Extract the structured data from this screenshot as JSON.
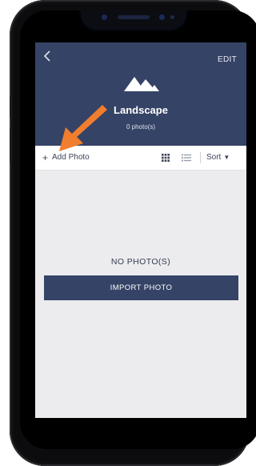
{
  "header": {
    "back_icon": "chevron-left-icon",
    "edit_label": "EDIT",
    "album_icon": "mountain-icon",
    "album_title": "Landscape",
    "photo_count": "0 photo(s)"
  },
  "toolbar": {
    "add_photo_label": "Add Photo",
    "add_icon": "plus-icon",
    "grid_icon": "grid-view-icon",
    "list_icon": "list-view-icon",
    "sort_label": "Sort",
    "sort_caret": "▼"
  },
  "content": {
    "empty_label": "NO PHOTO(S)",
    "import_button_label": "IMPORT PHOTO"
  },
  "annotation": {
    "arrow_icon": "orange-arrow-icon",
    "color": "#f07e2e"
  },
  "colors": {
    "header_bg": "#354366",
    "screen_bg": "#ececee",
    "accent": "#f07e2e"
  }
}
